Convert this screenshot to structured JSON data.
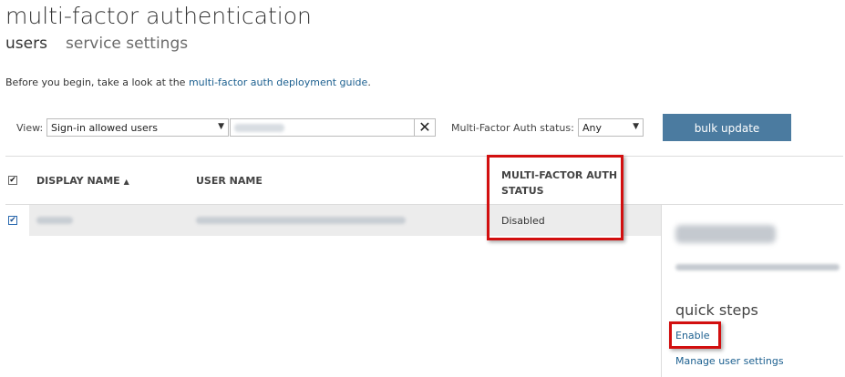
{
  "page": {
    "title": "multi-factor authentication",
    "tabs": [
      "users",
      "service settings"
    ]
  },
  "intro": {
    "text_before": "Before you begin, take a look at the ",
    "link": "multi-factor auth deployment guide",
    "text_after": "."
  },
  "filters": {
    "view_label": "View:",
    "view_value": "Sign-in allowed users",
    "search_clear_icon": "close-icon",
    "mfa_status_label": "Multi-Factor Auth status:",
    "mfa_status_value": "Any"
  },
  "bulk_update_label": "bulk update",
  "table": {
    "columns": [
      "DISPLAY NAME",
      "USER NAME",
      "MULTI-FACTOR AUTH STATUS"
    ],
    "sort_icon": "sort-up-icon",
    "rows": [
      {
        "mfa_status": "Disabled",
        "checked": true
      }
    ]
  },
  "side_panel": {
    "quick_steps_title": "quick steps",
    "enable_link": "Enable",
    "manage_link": "Manage user settings"
  },
  "colors": {
    "accent_button": "#4b7ba0",
    "link": "#1b5f8f",
    "highlight": "#d20f0f"
  }
}
